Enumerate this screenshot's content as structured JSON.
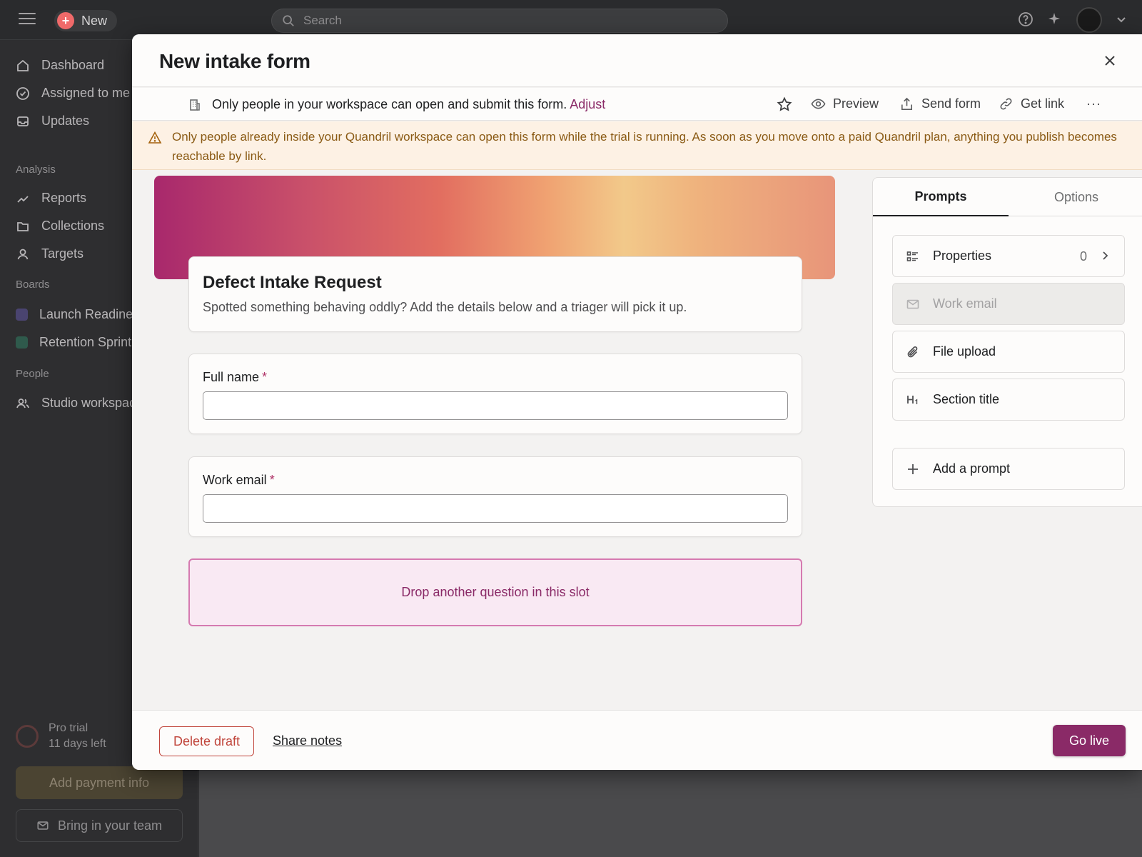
{
  "topbar": {
    "new_label": "New",
    "search_placeholder": "Search"
  },
  "sidebar": {
    "items": [
      {
        "label": "Dashboard",
        "icon": "home-icon"
      },
      {
        "label": "Assigned to me",
        "icon": "check-circle-icon"
      },
      {
        "label": "Updates",
        "icon": "inbox-icon"
      }
    ],
    "analysis_heading": "Analysis",
    "analysis_items": [
      {
        "label": "Reports",
        "icon": "trend-icon"
      },
      {
        "label": "Collections",
        "icon": "folder-icon"
      },
      {
        "label": "Targets",
        "icon": "person-icon"
      }
    ],
    "boards_heading": "Boards",
    "boards": [
      {
        "label": "Launch Readiness",
        "color": "#6d5fa8"
      },
      {
        "label": "Retention Sprint",
        "color": "#3f7a67"
      }
    ],
    "people_heading": "People",
    "people_items": [
      {
        "label": "Studio workspace",
        "icon": "people-icon"
      }
    ],
    "trial_title": "Pro trial",
    "trial_days": "11 days left",
    "payment_button": "Add payment info",
    "team_button": "Bring in your team"
  },
  "modal": {
    "title": "New intake form",
    "permission_text": "Only people in your workspace can open and submit this form.",
    "permission_link": "Adjust",
    "toolbar": {
      "preview": "Preview",
      "send": "Send form",
      "link": "Get link",
      "more": "···"
    },
    "banner_text": "Only people already inside your Quandril workspace can open this form while the trial is running. As soon as you move onto a paid Quandril plan, anything you publish becomes reachable by link.",
    "form": {
      "title": "Defect Intake Request",
      "description": "Spotted something behaving oddly? Add the details below and a triager will pick it up.",
      "questions": [
        {
          "label": "Full name",
          "required_mark": "*",
          "value": ""
        },
        {
          "label": "Work email",
          "required_mark": "*",
          "value": ""
        }
      ],
      "drop_slot": "Drop another question in this slot"
    },
    "panel": {
      "tabs": [
        "Prompts",
        "Options"
      ],
      "active_tab": "Prompts",
      "prompts": [
        {
          "label": "Properties",
          "count": "0",
          "icon": "list-icon"
        },
        {
          "label": "Work email",
          "icon": "mail-icon",
          "disabled": true
        },
        {
          "label": "File upload",
          "icon": "paperclip-icon"
        },
        {
          "label": "Section title",
          "icon": "heading-icon"
        }
      ],
      "add_prompt": "Add a prompt"
    },
    "footer": {
      "delete": "Delete draft",
      "share": "Share notes",
      "go_live": "Go live"
    }
  },
  "colors": {
    "accent": "#8a2a67",
    "danger": "#c0453b",
    "warning_bg": "#fdf1e4",
    "warning_text": "#8a5a14"
  }
}
